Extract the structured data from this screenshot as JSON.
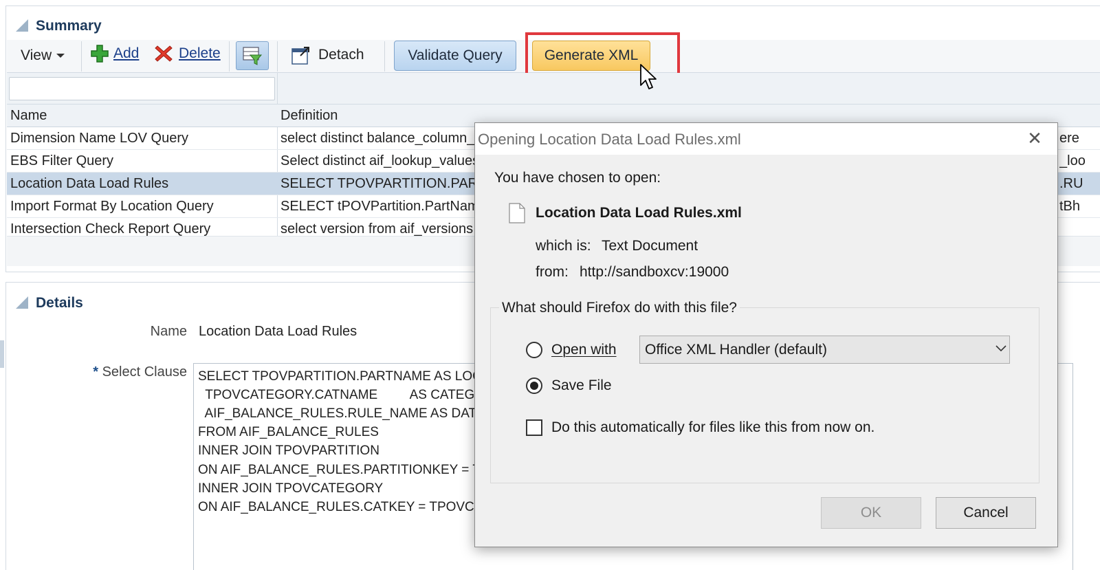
{
  "summary": {
    "title": "Summary",
    "toolbar": {
      "view_label": "View",
      "add_label": "Add",
      "delete_label": "Delete",
      "detach_label": "Detach",
      "validate_label": "Validate Query",
      "generate_label": "Generate XML"
    },
    "filter_value": "",
    "columns": [
      "Name",
      "Definition"
    ],
    "rows": [
      {
        "name": "Dimension Name LOV Query",
        "definition": "select distinct balance_column_name",
        "tail": "ere"
      },
      {
        "name": "EBS Filter Query",
        "definition": "Select distinct aif_lookup_values",
        "tail": "_loo"
      },
      {
        "name": "Location Data Load Rules",
        "definition": "SELECT TPOVPARTITION.PARTNAME",
        "tail": ".RU"
      },
      {
        "name": "Import Format By Location Query",
        "definition": "SELECT tPOVPartition.PartName",
        "tail": "tBh"
      },
      {
        "name": "Intersection Check Report Query",
        "definition": "select version from aif_versions",
        "tail": ""
      }
    ],
    "selected_row_index": 2
  },
  "details": {
    "title": "Details",
    "name_label": "Name",
    "name_value": "Location Data Load Rules",
    "required_mark": "*",
    "select_label": "Select Clause",
    "select_lines": [
      "SELECT TPOVPARTITION.PARTNAME AS LOCATION,",
      "  TPOVCATEGORY.CATNAME         AS CATEGORY,",
      "  AIF_BALANCE_RULES.RULE_NAME AS DATA_LOAD_RULE",
      "FROM AIF_BALANCE_RULES",
      "INNER JOIN TPOVPARTITION",
      "ON AIF_BALANCE_RULES.PARTITIONKEY = TPOVPARTITION.PARTITIONKEY",
      "INNER JOIN TPOVCATEGORY",
      "ON AIF_BALANCE_RULES.CATKEY = TPOVCATEGORY.CATKEY"
    ]
  },
  "dialog": {
    "title": "Opening Location Data Load Rules.xml",
    "close_glyph": "✕",
    "intro": "You have chosen to open:",
    "filename": "Location Data Load Rules.xml",
    "which_is_label": "which is:",
    "which_is_value": "Text Document",
    "from_label": "from:",
    "from_value": "http://sandboxcv:19000",
    "question": "What should Firefox do with this file?",
    "open_with_label": "Open with",
    "open_with_value": "Office XML Handler (default)",
    "save_file_label": "Save File",
    "selected_option": "save",
    "auto_label": "Do this automatically for files like this from now on.",
    "auto_checked": false,
    "ok_label": "OK",
    "cancel_label": "Cancel"
  },
  "colors": {
    "accent_highlight": "#e0393e",
    "selected_row": "#c9d8e8",
    "primary_button": "#b9d4ef",
    "generate_button": "#f8c860",
    "panel_title": "#1d3a5c"
  }
}
